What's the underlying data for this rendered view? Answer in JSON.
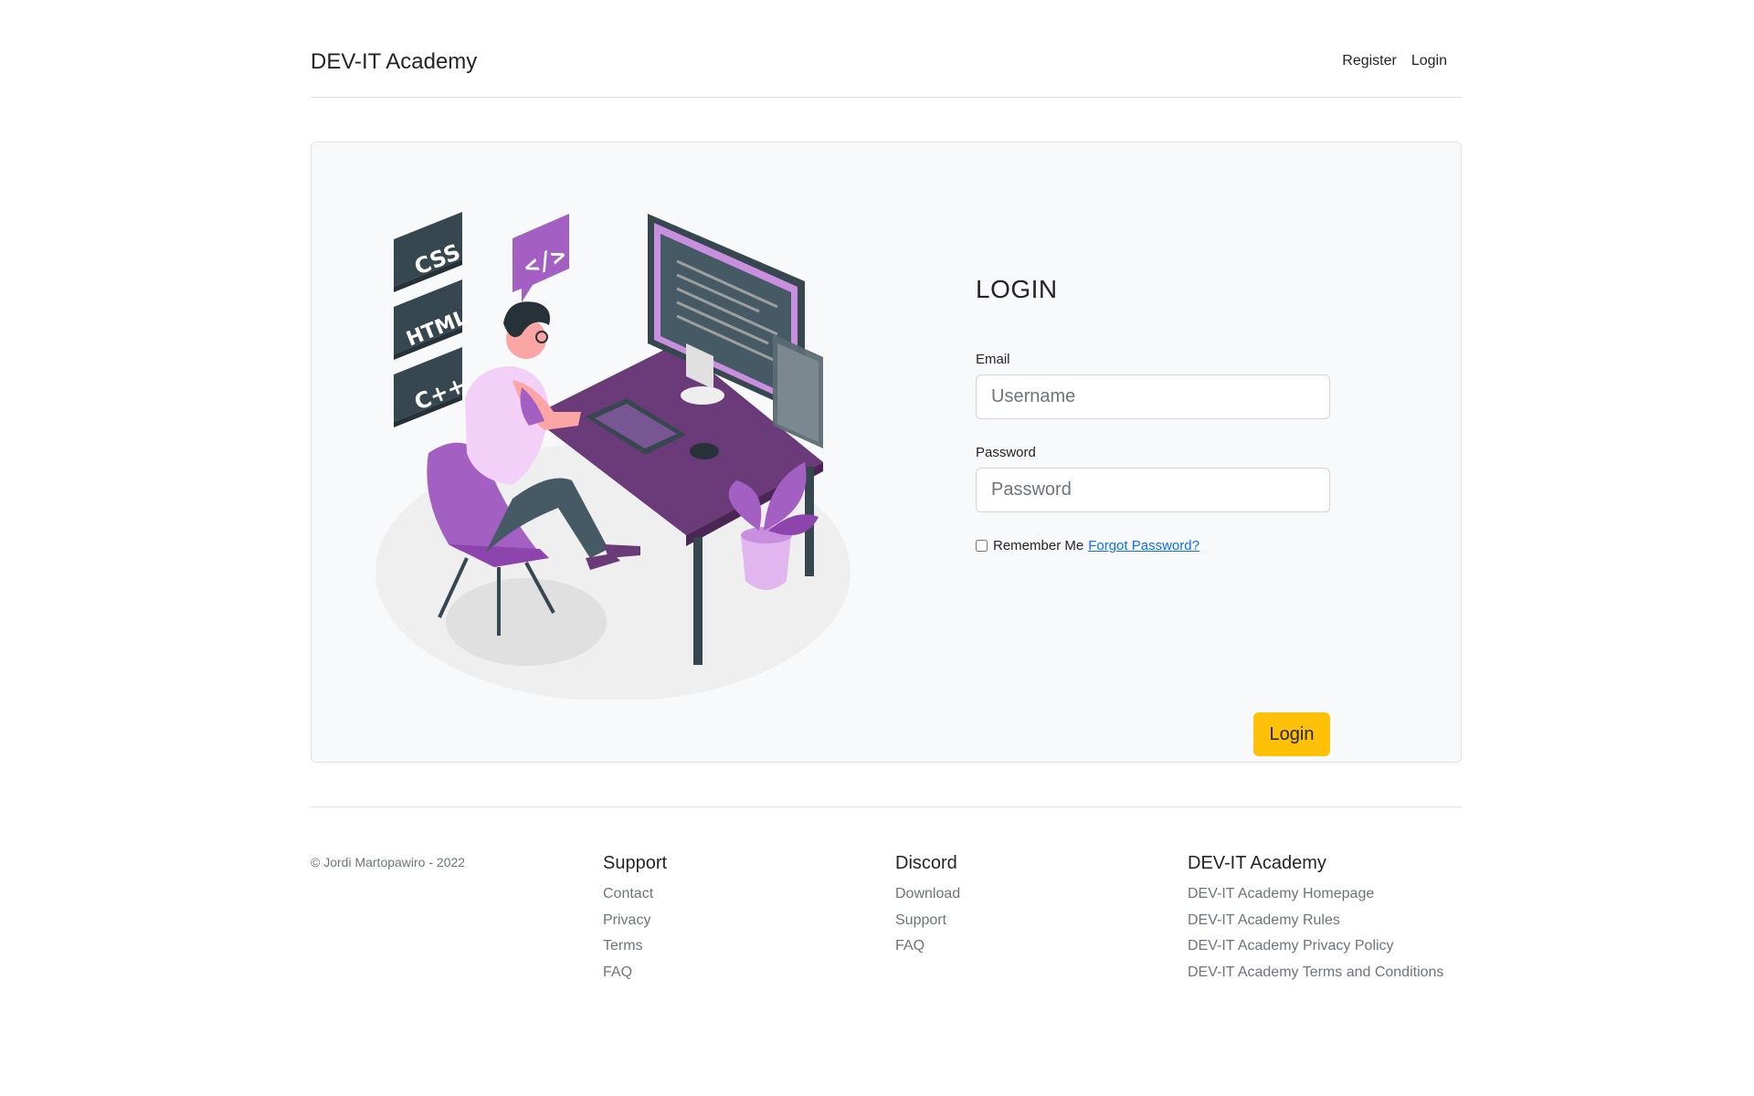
{
  "header": {
    "brand": "DEV-IT Academy",
    "nav": [
      "Register",
      "Login"
    ]
  },
  "illustration": {
    "badges": [
      "CSS",
      "HTML",
      "C++"
    ],
    "code_bubble": "</>"
  },
  "login": {
    "title": "LOGIN",
    "email_label": "Email",
    "email_placeholder": "Username",
    "password_label": "Password",
    "password_placeholder": "Password",
    "remember_label": "Remember Me",
    "forgot_link": "Forgot Password?",
    "submit_label": "Login"
  },
  "footer": {
    "copyright": "© Jordi Martopawiro - 2022",
    "columns": [
      {
        "title": "Support",
        "links": [
          "Contact",
          "Privacy",
          "Terms",
          "FAQ"
        ]
      },
      {
        "title": "Discord",
        "links": [
          "Download",
          "Support",
          "FAQ"
        ]
      },
      {
        "title": "DEV-IT Academy",
        "links": [
          "DEV-IT Academy Homepage",
          "DEV-IT Academy Rules",
          "DEV-IT Academy Privacy Policy",
          "DEV-IT Academy Terms and Conditions"
        ]
      }
    ]
  },
  "colors": {
    "accent_button": "#ffc107",
    "link": "#0d6efd",
    "card_bg": "#f8f9fa",
    "illustration_purple": "#a35fc2",
    "illustration_dark": "#37474f"
  }
}
